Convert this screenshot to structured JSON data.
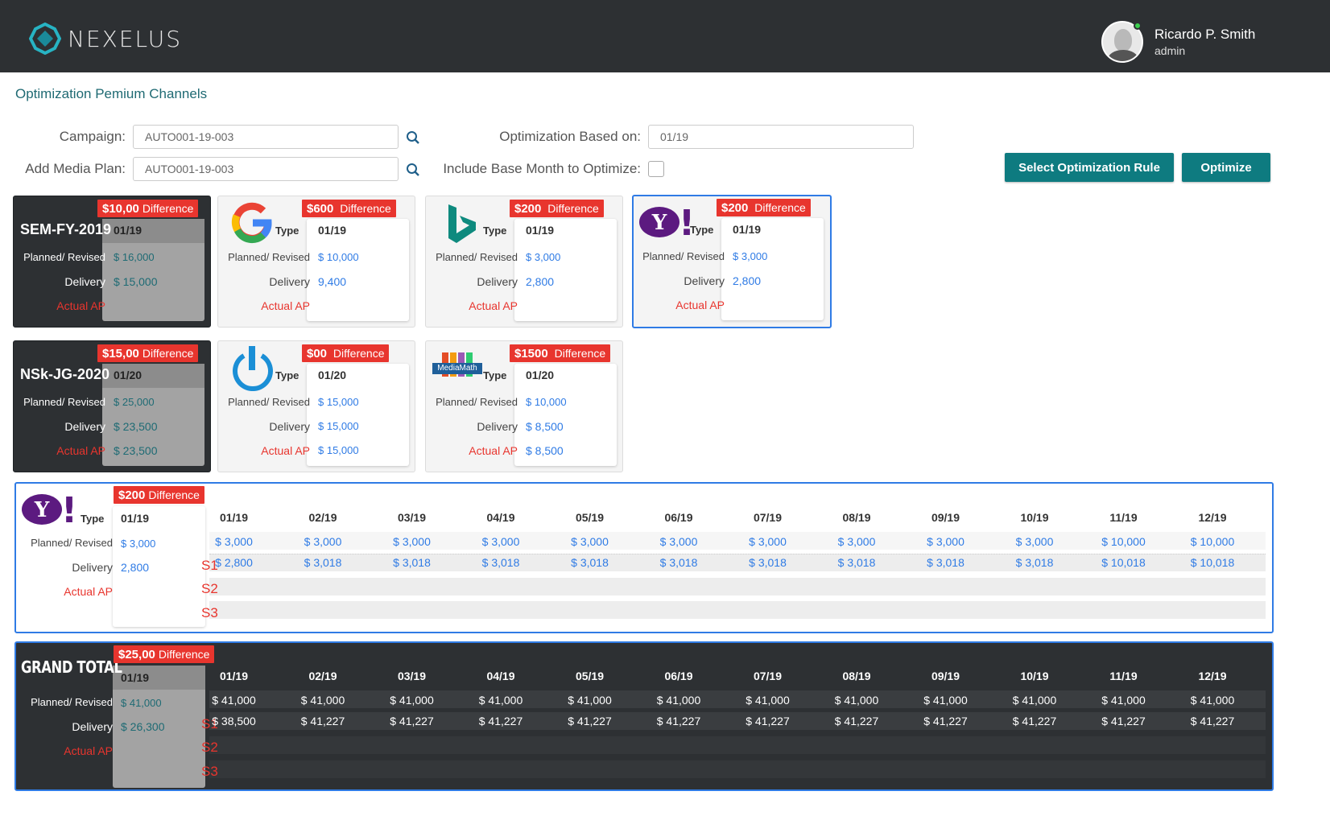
{
  "app": {
    "brand": "NEXELUS"
  },
  "user": {
    "name": "Ricardo P. Smith",
    "role": "admin"
  },
  "page": {
    "title": "Optimization Pemium Channels"
  },
  "form": {
    "campaign_label": "Campaign:",
    "campaign_value": "AUTO001-19-003",
    "media_plan_label": "Add Media Plan:",
    "media_plan_value": "AUTO001-19-003",
    "opt_based_label": "Optimization Based on:",
    "opt_based_value": "01/19",
    "include_base_label": "Include Base Month to Optimize:",
    "select_rule_button": "Select Optimization Rule",
    "optimize_button": "Optimize"
  },
  "labels": {
    "type": "Type",
    "planned": "Planned/ Revised",
    "delivery": "Delivery",
    "actual": "Actual AP",
    "difference": "Difference"
  },
  "cards_row1": [
    {
      "name": "SEM-FY-2019",
      "diff": "$10,00",
      "month": "01/19",
      "planned": "$ 16,000",
      "delivery": "$ 15,000",
      "actual": ""
    },
    {
      "logo": "google-logo",
      "diff": "$600",
      "month": "01/19",
      "planned": "$ 10,000",
      "delivery": "9,400",
      "actual": ""
    },
    {
      "logo": "bing-logo",
      "diff": "$200",
      "month": "01/19",
      "planned": "$ 3,000",
      "delivery": "2,800",
      "actual": ""
    },
    {
      "logo": "yahoo-logo",
      "diff": "$200",
      "month": "01/19",
      "planned": "$ 3,000",
      "delivery": "2,800",
      "actual": ""
    }
  ],
  "cards_row2": [
    {
      "name": "NSk-JG-2020",
      "diff": "$15,00",
      "month": "01/20",
      "planned": "$ 25,000",
      "delivery": "$ 23,500",
      "actual": "$ 23,500"
    },
    {
      "logo": "power-logo",
      "diff": "$00",
      "month": "01/20",
      "planned": "$ 15,000",
      "delivery": "$ 15,000",
      "actual": "$ 15,000"
    },
    {
      "logo": "mediamath-logo",
      "logo_text": "MediaMath",
      "diff": "$1500",
      "month": "01/20",
      "planned": "$ 10,000",
      "delivery": "$ 8,500",
      "actual": "$ 8,500"
    }
  ],
  "detail": {
    "diff": "$200",
    "month": "01/19",
    "planned": "$ 3,000",
    "delivery": "2,800",
    "scenarios": [
      "S1",
      "S2",
      "S3"
    ],
    "months": [
      "01/19",
      "02/19",
      "03/19",
      "04/19",
      "05/19",
      "06/19",
      "07/19",
      "08/19",
      "09/19",
      "10/19",
      "11/19",
      "12/19"
    ],
    "planned_row": [
      "$ 3,000",
      "$ 3,000",
      "$ 3,000",
      "$ 3,000",
      "$ 3,000",
      "$ 3,000",
      "$ 3,000",
      "$ 3,000",
      "$ 3,000",
      "$ 3,000",
      "$ 10,000",
      "$ 10,000"
    ],
    "s1_row": [
      "$ 2,800",
      "$ 3,018",
      "$ 3,018",
      "$ 3,018",
      "$ 3,018",
      "$ 3,018",
      "$ 3,018",
      "$ 3,018",
      "$ 3,018",
      "$ 3,018",
      "$ 10,018",
      "$ 10,018"
    ]
  },
  "grand_total": {
    "title": "GRAND TOTAL",
    "diff": "$25,00",
    "month": "01/19",
    "planned": "$ 41,000",
    "delivery": "$ 26,300",
    "scenarios": [
      "S1",
      "S2",
      "S3"
    ],
    "months": [
      "01/19",
      "02/19",
      "03/19",
      "04/19",
      "05/19",
      "06/19",
      "07/19",
      "08/19",
      "09/19",
      "10/19",
      "11/19",
      "12/19"
    ],
    "planned_row": [
      "$ 41,000",
      "$ 41,000",
      "$ 41,000",
      "$ 41,000",
      "$ 41,000",
      "$ 41,000",
      "$ 41,000",
      "$ 41,000",
      "$ 41,000",
      "$ 41,000",
      "$ 41,000",
      "$ 41,000"
    ],
    "s1_row": [
      "$ 38,500",
      "$ 41,227",
      "$ 41,227",
      "$ 41,227",
      "$ 41,227",
      "$ 41,227",
      "$ 41,227",
      "$ 41,227",
      "$ 41,227",
      "$ 41,227",
      "$ 41,227",
      "$ 41,227"
    ]
  },
  "colors": {
    "header": "#2d3033",
    "accent": "#0e7b80",
    "difference": "#e8352e",
    "link": "#2f7be5"
  }
}
